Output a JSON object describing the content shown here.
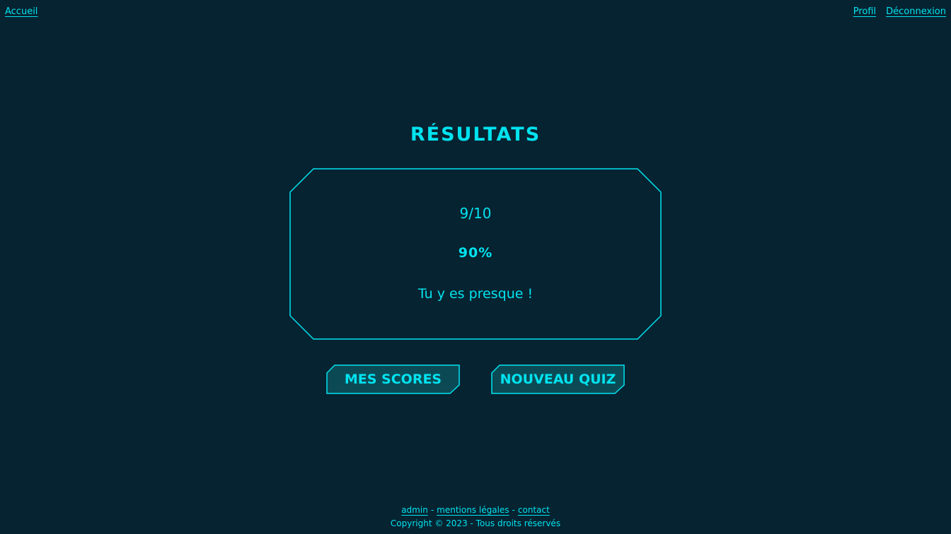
{
  "nav": {
    "home": "Accueil",
    "profile": "Profil",
    "logout": "Déconnexion"
  },
  "results": {
    "title": "RÉSULTATS",
    "score": "9/10",
    "percent": "90%",
    "message": "Tu y es presque !"
  },
  "buttons": {
    "scores": "MES SCORES",
    "new_quiz": "NOUVEAU QUIZ"
  },
  "footer": {
    "admin": "admin",
    "separator": "-",
    "legal": "mentions légales",
    "contact": "contact",
    "copyright": "Copyright © 2023 - Tous droits réservés"
  },
  "colors": {
    "background": "#062331",
    "accent": "#00e3ef",
    "button_fill": "#0b4a55"
  }
}
